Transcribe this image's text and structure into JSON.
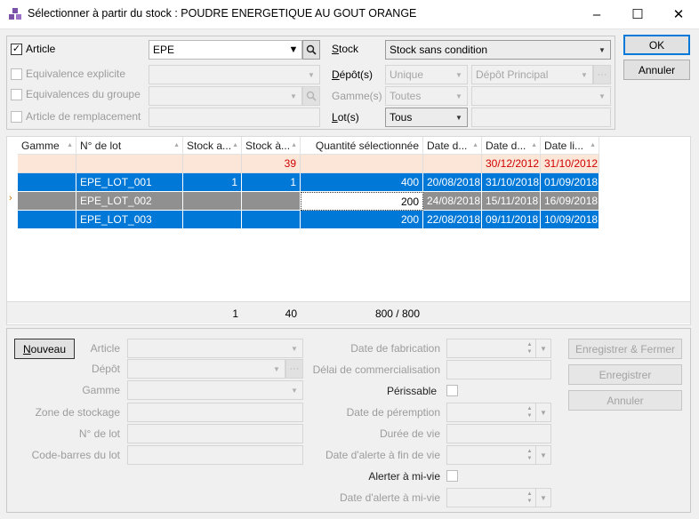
{
  "window": {
    "title": "Sélectionner à partir du stock : POUDRE ENERGETIQUE AU GOUT ORANGE",
    "minimize": "–",
    "maximize": "☐",
    "close": "✕"
  },
  "filters": {
    "article_label": "Article",
    "article_value": "EPE",
    "equiv_explicite_label": "Equivalence explicite",
    "equiv_groupe_label": "Equivalences du groupe",
    "article_remplacement_label": "Article de remplacement",
    "stock_label": "Stock",
    "stock_value": "Stock sans condition",
    "depot_label": "Dépôt(s)",
    "depot_mode": "Unique",
    "depot_value": "Dépôt Principal",
    "gamme_label": "Gamme(s)",
    "gamme_mode": "Toutes",
    "lot_label": "Lot(s)",
    "lot_mode": "Tous"
  },
  "actions": {
    "ok": "OK",
    "annuler": "Annuler"
  },
  "grid": {
    "columns": [
      "Gamme",
      "N° de lot",
      "Stock a...",
      "Stock à...",
      "Quantité sélectionnée",
      "Date d...",
      "Date d...",
      "Date li..."
    ],
    "summary_row": [
      "",
      "",
      "",
      "39",
      "",
      "",
      "30/12/2012",
      "31/10/2012"
    ],
    "rows": [
      [
        "",
        "EPE_LOT_001",
        "1",
        "1",
        "400",
        "20/08/2018",
        "31/10/2018",
        "01/09/2018"
      ],
      [
        "",
        "EPE_LOT_002",
        "",
        "",
        "200",
        "24/08/2018",
        "15/11/2018",
        "16/09/2018"
      ],
      [
        "",
        "EPE_LOT_003",
        "",
        "",
        "200",
        "22/08/2018",
        "09/11/2018",
        "10/09/2018"
      ]
    ],
    "row_marker": "›",
    "footer": {
      "stock_total": "1",
      "stock_a_total": "40",
      "quantite_total": "800 / 800"
    }
  },
  "detail": {
    "nouveau": "Nouveau",
    "article_label": "Article",
    "depot_label": "Dépôt",
    "gamme_label": "Gamme",
    "zone_label": "Zone de stockage",
    "lot_label": "N° de lot",
    "codebarres_label": "Code-barres du lot",
    "date_fab_label": "Date de fabrication",
    "delai_label": "Délai de commercialisation",
    "perissable_label": "Périssable",
    "date_peremption_label": "Date de péremption",
    "duree_label": "Durée de vie",
    "date_alerte_fin_label": "Date d'alerte à fin de vie",
    "alerter_label": "Alerter à mi-vie",
    "date_alerte_mi_label": "Date d'alerte à mi-vie",
    "enregistrer_fermer": "Enregistrer & Fermer",
    "enregistrer": "Enregistrer",
    "annuler": "Annuler"
  }
}
